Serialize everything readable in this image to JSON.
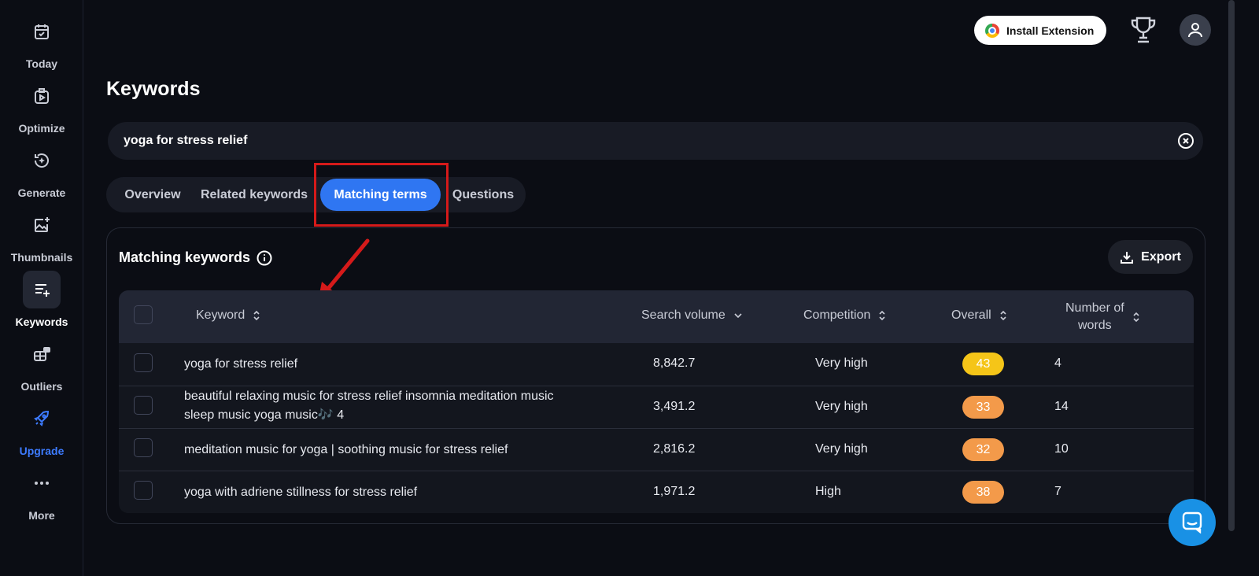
{
  "sidebar": {
    "items": [
      {
        "label": "Today",
        "icon": "calendar-check-icon"
      },
      {
        "label": "Optimize",
        "icon": "video-clipboard-icon"
      },
      {
        "label": "Generate",
        "icon": "sparkle-refresh-icon"
      },
      {
        "label": "Thumbnails",
        "icon": "image-sparkle-icon"
      },
      {
        "label": "Keywords",
        "icon": "list-plus-icon"
      },
      {
        "label": "Outliers",
        "icon": "outliers-icon"
      },
      {
        "label": "Upgrade",
        "icon": "rocket-icon"
      },
      {
        "label": "More",
        "icon": "more-dots-icon"
      }
    ],
    "active": "Keywords",
    "upgrade_color": "#3d7bff"
  },
  "header": {
    "install_label": "Install Extension"
  },
  "page": {
    "title": "Keywords"
  },
  "search": {
    "value": "yoga for stress relief"
  },
  "tabs": [
    {
      "label": "Overview"
    },
    {
      "label": "Related keywords"
    },
    {
      "label": "Matching terms"
    },
    {
      "label": "Questions"
    }
  ],
  "active_tab": "Matching terms",
  "panel": {
    "title": "Matching keywords",
    "export_label": "Export"
  },
  "table": {
    "columns": {
      "keyword": "Keyword",
      "search_volume": "Search volume",
      "competition": "Competition",
      "overall": "Overall",
      "words_1": "Number of",
      "words_2": "words"
    },
    "rows": [
      {
        "keyword": "yoga for stress relief",
        "keyword_2": "",
        "volume": "8,842.7",
        "competition": "Very high",
        "overall": "43",
        "overall_color": "#f5c518",
        "words": "4"
      },
      {
        "keyword": "beautiful relaxing music for stress relief insomnia meditation music",
        "keyword_2": "sleep music yoga music🎶 4",
        "volume": "3,491.2",
        "competition": "Very high",
        "overall": "33",
        "overall_color": "#f39a4a",
        "words": "14"
      },
      {
        "keyword": "meditation music for yoga | soothing music for stress relief",
        "keyword_2": "",
        "volume": "2,816.2",
        "competition": "Very high",
        "overall": "32",
        "overall_color": "#f39a4a",
        "words": "10"
      },
      {
        "keyword": "yoga with adriene stillness for stress relief",
        "keyword_2": "",
        "volume": "1,971.2",
        "competition": "High",
        "overall": "38",
        "overall_color": "#f39a4a",
        "words": "7"
      }
    ]
  },
  "colors": {
    "accent": "#2f76f2",
    "highlight": "#d51a1a",
    "chat": "#1991e5"
  }
}
